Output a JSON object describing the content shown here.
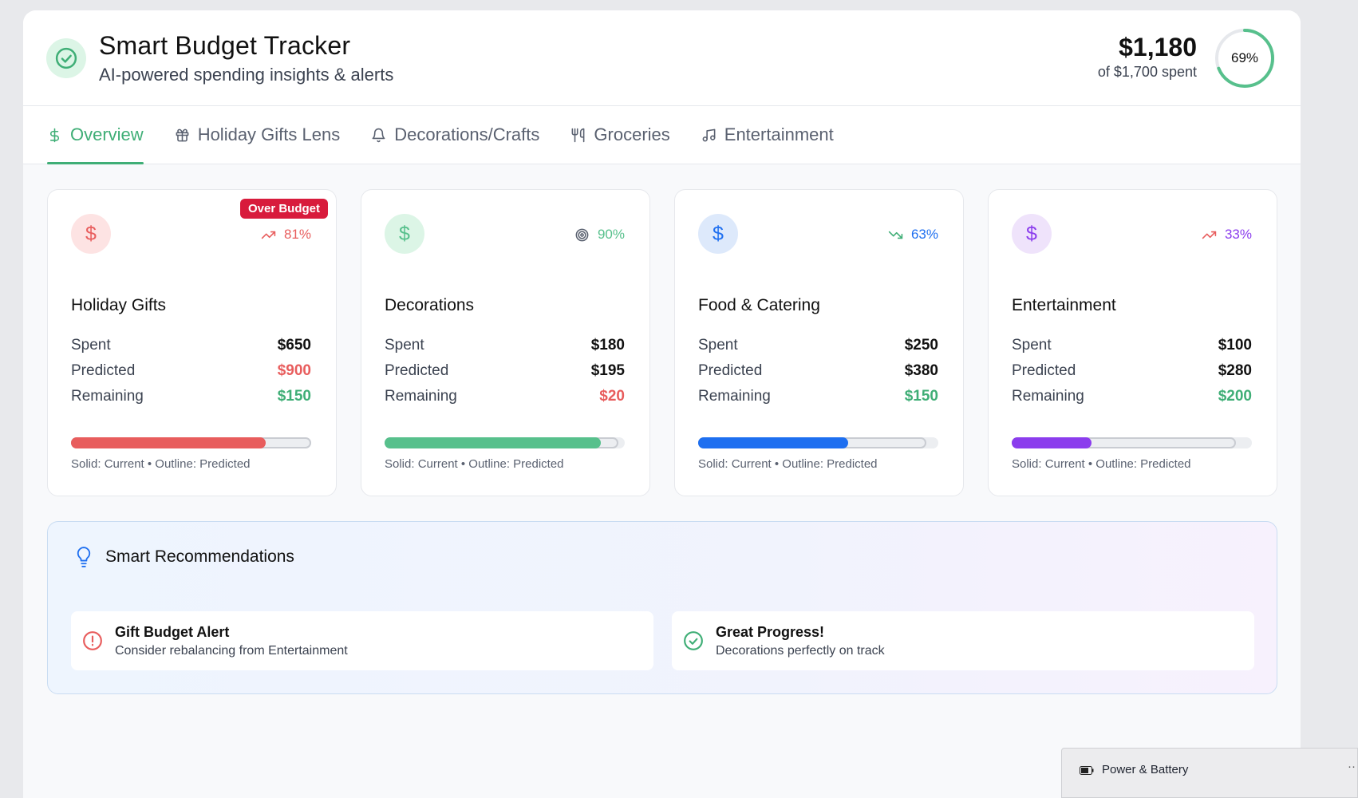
{
  "header": {
    "title": "Smart Budget Tracker",
    "subtitle": "AI-powered spending insights & alerts",
    "total_amount": "$1,180",
    "total_sub": "of $1,700 spent",
    "progress_label": "69%",
    "progress_fraction": 0.69
  },
  "tabs": [
    {
      "label": "Overview",
      "icon": "dollar-icon",
      "active": true
    },
    {
      "label": "Holiday Gifts Lens",
      "icon": "gift-icon",
      "active": false
    },
    {
      "label": "Decorations/Crafts",
      "icon": "bell-icon",
      "active": false
    },
    {
      "label": "Groceries",
      "icon": "utensils-icon",
      "active": false
    },
    {
      "label": "Entertainment",
      "icon": "music-icon",
      "active": false
    }
  ],
  "cards": [
    {
      "name": "Holiday Gifts",
      "badge": "Over Budget",
      "trend": "81%",
      "trend_icon": "trending-up-icon",
      "color": "#e85d5d",
      "icon_bg": "#fde3e3",
      "spent_label": "Spent",
      "spent": "$650",
      "predicted_label": "Predicted",
      "predicted": "$900",
      "predicted_color": "#e85d5d",
      "remaining_label": "Remaining",
      "remaining": "$150",
      "remaining_color": "#3fae76",
      "current_fraction": 0.81,
      "predicted_fraction": 1.0,
      "legend": "Solid: Current • Outline: Predicted"
    },
    {
      "name": "Decorations",
      "badge": "",
      "trend": "90%",
      "trend_icon": "target-icon",
      "color": "#57c08c",
      "icon_bg": "#dcf5e6",
      "spent_label": "Spent",
      "spent": "$180",
      "predicted_label": "Predicted",
      "predicted": "$195",
      "predicted_color": "#111111",
      "remaining_label": "Remaining",
      "remaining": "$20",
      "remaining_color": "#e85d5d",
      "current_fraction": 0.9,
      "predicted_fraction": 0.975,
      "legend": "Solid: Current • Outline: Predicted"
    },
    {
      "name": "Food & Catering",
      "badge": "",
      "trend": "63%",
      "trend_icon": "trending-down-icon",
      "color": "#1e6ff0",
      "icon_bg": "#dde9fb",
      "spent_label": "Spent",
      "spent": "$250",
      "predicted_label": "Predicted",
      "predicted": "$380",
      "predicted_color": "#111111",
      "remaining_label": "Remaining",
      "remaining": "$150",
      "remaining_color": "#3fae76",
      "current_fraction": 0.625,
      "predicted_fraction": 0.95,
      "legend": "Solid: Current • Outline: Predicted"
    },
    {
      "name": "Entertainment",
      "badge": "",
      "trend": "33%",
      "trend_icon": "trending-up-icon",
      "color": "#8b3ded",
      "icon_bg": "#efe3fb",
      "spent_label": "Spent",
      "spent": "$100",
      "predicted_label": "Predicted",
      "predicted": "$280",
      "predicted_color": "#111111",
      "remaining_label": "Remaining",
      "remaining": "$200",
      "remaining_color": "#3fae76",
      "current_fraction": 0.333,
      "predicted_fraction": 0.933,
      "legend": "Solid: Current • Outline: Predicted"
    }
  ],
  "recommendations": {
    "title": "Smart Recommendations",
    "items": [
      {
        "title": "Gift Budget Alert",
        "desc": "Consider rebalancing from Entertainment",
        "icon": "alert-circle-icon",
        "color": "#e85d5d"
      },
      {
        "title": "Great Progress!",
        "desc": "Decorations perfectly on track",
        "icon": "check-circle-icon",
        "color": "#3fae76"
      }
    ]
  },
  "system_popup": {
    "label": "Power & Battery",
    "more": "··"
  }
}
